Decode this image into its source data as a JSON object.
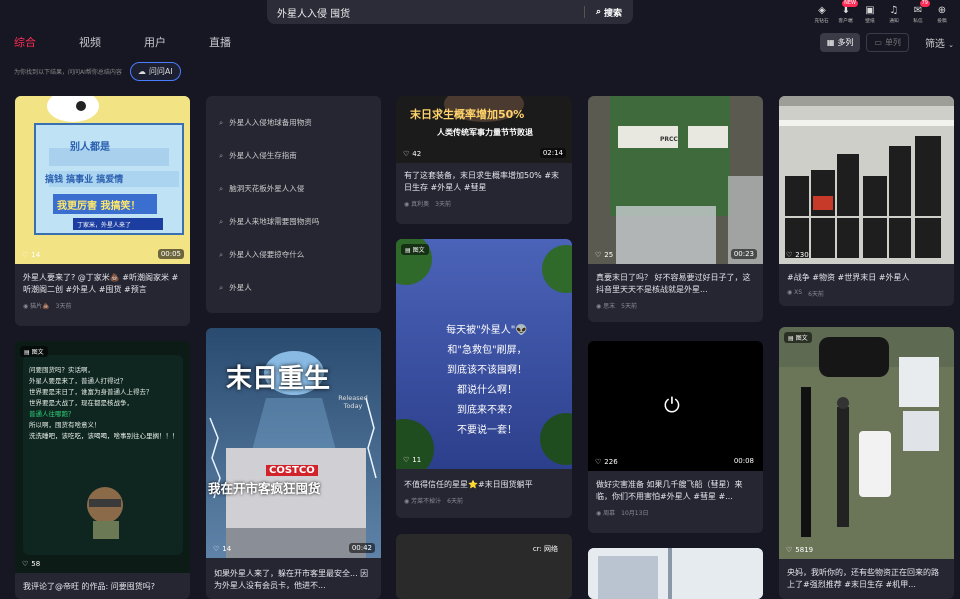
{
  "search": {
    "query": "外星人入侵 囤货",
    "button": "搜索"
  },
  "top_icons": [
    {
      "name": "recharge-icon",
      "glyph": "◈",
      "label": "充钻石",
      "badge": ""
    },
    {
      "name": "client-icon",
      "glyph": "⬇",
      "label": "客户端",
      "badge": "NEW"
    },
    {
      "name": "wallpaper-icon",
      "glyph": "▣",
      "label": "壁纸",
      "badge": ""
    },
    {
      "name": "notification-icon",
      "glyph": "♫",
      "label": "通知",
      "badge": ""
    },
    {
      "name": "message-icon",
      "glyph": "✉",
      "label": "私信",
      "badge": "79"
    },
    {
      "name": "upload-icon",
      "glyph": "⊕",
      "label": "投稿",
      "badge": ""
    }
  ],
  "tabs": [
    "综合",
    "视频",
    "用户",
    "直播"
  ],
  "view": {
    "multi": "多列",
    "single": "单列",
    "filter": "筛选"
  },
  "ai": {
    "hint": "为你找到以下结果，问问AI帮你总结内容",
    "button": "问问AI"
  },
  "cards": [
    {
      "id": "c1",
      "title": "外星人要来了? @丁家米💩 #听潮阁家米 #听潮阁二创 #外星人 #囤货 #预言",
      "author": "猫片💩",
      "time": "3天前",
      "likes": "14",
      "duration": "00:05",
      "img_text": [
        "别人都是",
        "搞钱 搞事业 搞爱情",
        "我更厉害 我搞笑！",
        "丁家米，外星人来了"
      ]
    },
    {
      "id": "c3",
      "title": "有了这套装备，末日求生概率增加50% #末日生存 #外星人 #彗星",
      "author": "真利奥",
      "time": "3天前",
      "likes": "42",
      "duration": "02:14",
      "img_text": [
        "末日求生概率增加50%",
        "人类传统军事力量节节败退"
      ]
    },
    {
      "id": "c4",
      "title": "真要末日了吗？ 好不容易要过好日子了，这抖音里天天不是核战就是外星...",
      "author": "思末",
      "time": "5天前",
      "likes": "25",
      "duration": "00:23",
      "img_text": [
        "PRCC"
      ]
    },
    {
      "id": "c5",
      "title": "#战争 #物资 #世界末日 #外星人",
      "author": "XS",
      "time": "6天前",
      "likes": "230",
      "duration": "",
      "img_text": []
    },
    {
      "id": "c6",
      "tag": "图文",
      "title": "我评论了@帝旺 的作品: 问要囤货吗?",
      "author": "",
      "time": "",
      "likes": "58",
      "duration": "",
      "img_text": [
        "问要囤货吗？实话啊，",
        "外星人要是来了，普通人打得过？",
        "世界要是末日了，谁富为身普通人上得去？",
        "世界要是大战了，现在都是核战争，",
        "普通人往哪跑？",
        "所以啊，囤货有啥意义！",
        "洗洗睡吧，该吃吃，该喝喝，啥事别往心里搁！！！"
      ]
    },
    {
      "id": "c7",
      "title": "如果外星人来了，躲在开市客里最安全... 因为外星人没有会员卡，他进不...",
      "author": "",
      "time": "",
      "likes": "14",
      "duration": "00:42",
      "img_text": [
        "末日重生",
        "Released Today",
        "COSTCO",
        "我在开市客疯狂囤货"
      ]
    },
    {
      "id": "c8",
      "tag": "图文",
      "title": "不值得信任的星星⭐#末日囤货躺平",
      "author": "芳菜不掉汁",
      "time": "6天前",
      "likes": "11",
      "duration": "",
      "img_text": [
        "每天被\"外星人\"👽",
        "和\"急救包\"刷屏，",
        "到底该不该囤啊！",
        "都说什么啊！",
        "到底来不来？",
        "不要说一套！"
      ]
    },
    {
      "id": "c9",
      "title": "做好灾害准备 如果几千艘飞船（彗星）来临，你们不用害怕#外星人 #彗星 #...",
      "author": "周慕",
      "time": "10月13日",
      "likes": "226",
      "duration": "00:08",
      "img_text": []
    },
    {
      "id": "c10",
      "tag": "图文",
      "title": "央妈，我听你的，还有些物资正在回来的路上了#强烈推荐 #末日生存 #机甲...",
      "author": "",
      "time": "",
      "likes": "5819",
      "duration": "",
      "img_text": []
    }
  ],
  "bottom_card": {
    "text": "cr: 网络"
  },
  "suggestions": [
    "外星人入侵地球备用物资",
    "外星人入侵生存指南",
    "脑洞天花板外星人入侵",
    "外星人来地球需要囤物资吗",
    "外星人入侵要掠夺什么",
    "外星人"
  ]
}
